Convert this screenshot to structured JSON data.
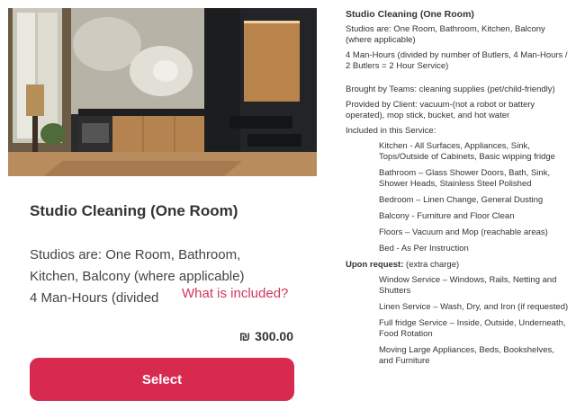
{
  "card": {
    "title": "Studio Cleaning (One Room)",
    "description_lines": [
      "Studios are: One Room, Bathroom,",
      "Kitchen, Balcony (where applicable)",
      "4 Man-Hours (divided "
    ],
    "included_link": "What is included?",
    "price_symbol": "₪",
    "price_value": "300.00",
    "select_label": "Select"
  },
  "details": {
    "title": "Studio Cleaning (One Room)",
    "studios": "Studios are: One Room, Bathroom, Kitchen, Balcony (where applicable)",
    "man_hours": "4 Man-Hours (divided by number of Butlers, 4 Man-Hours / 2 Butlers = 2 Hour Service)",
    "brought": "Brought by Teams: cleaning supplies (pet/child-friendly)",
    "provided": "Provided by Client: vacuum-(not a robot or battery operated), mop stick, bucket, and hot water",
    "included_heading": "Included in this Service:",
    "included_items": [
      "Kitchen - All Surfaces, Appliances, Sink, Tops/Outside of Cabinets, Basic wipping fridge",
      "Bathroom – Glass Shower Doors, Bath, Sink, Shower Heads, Stainless Steel Polished",
      "Bedroom – Linen Change, General Dusting",
      "Balcony - Furniture and Floor Clean",
      "Floors – Vacuum and Mop (reachable areas)",
      "Bed - As Per Instruction"
    ],
    "upon_request_label": "Upon request:",
    "upon_request_note": " (extra charge)",
    "request_items": [
      "Window Service – Windows, Rails, Netting and Shutters",
      "Linen Service – Wash, Dry, and Iron (if requested)",
      "Full fridge Service – Inside, Outside, Underneath, Food Rotation",
      "Moving Large Appliances, Beds, Bookshelves, and Furniture"
    ]
  }
}
